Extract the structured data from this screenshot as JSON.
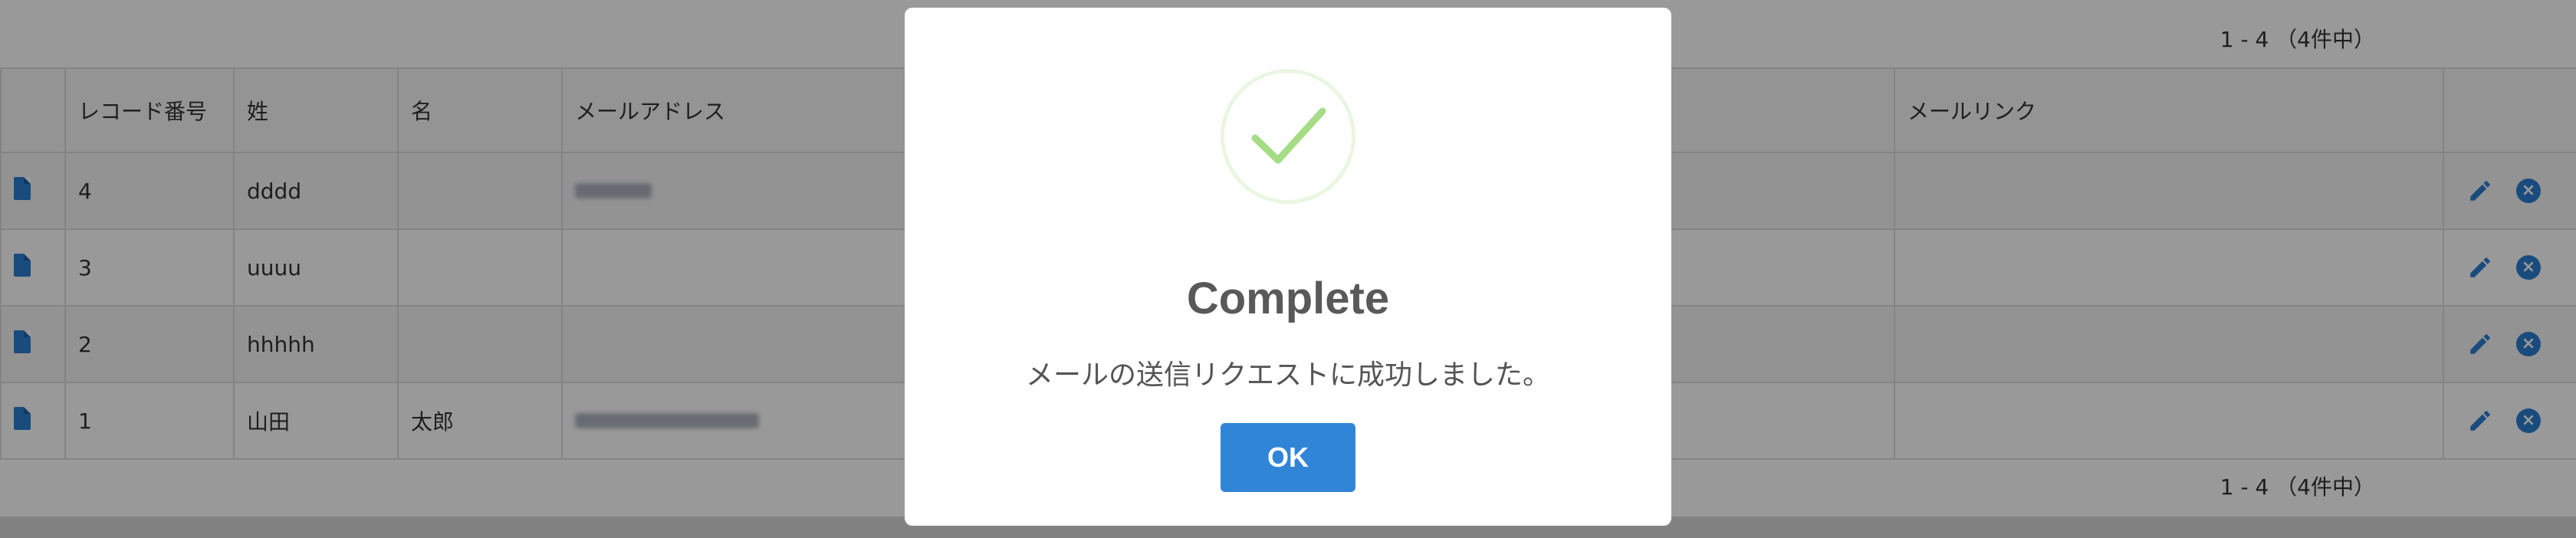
{
  "pagination": {
    "top_text": "1 - 4 （4件中）",
    "bottom_text": "1 - 4 （4件中）"
  },
  "table": {
    "headers": {
      "record_number": "レコード番号",
      "last_name": "姓",
      "first_name": "名",
      "email": "メールアドレス",
      "mail_link": "メールリンク"
    },
    "rows": [
      {
        "record_number": "4",
        "last_name": "dddd",
        "first_name": "",
        "email_blurred": true,
        "mail_link": ""
      },
      {
        "record_number": "3",
        "last_name": "uuuu",
        "first_name": "",
        "email_blurred": false,
        "mail_link": ""
      },
      {
        "record_number": "2",
        "last_name": "hhhhh",
        "first_name": "",
        "email_blurred": false,
        "mail_link": ""
      },
      {
        "record_number": "1",
        "last_name": "山田",
        "first_name": "太郎",
        "email_blurred": true,
        "mail_link": ""
      }
    ]
  },
  "icons": {
    "row_detail": "document-icon",
    "row_edit": "pencil-icon",
    "row_delete": "close-circle-icon",
    "modal_status": "check-icon"
  },
  "modal": {
    "title": "Complete",
    "message": "メールの送信リクエストに成功しました。",
    "ok_label": "OK"
  },
  "colors": {
    "accent": "#3085d6",
    "icon_blue": "#2a7fd0",
    "success_check": "#a5dc86",
    "overlay": "rgba(0,0,0,0.4)"
  }
}
